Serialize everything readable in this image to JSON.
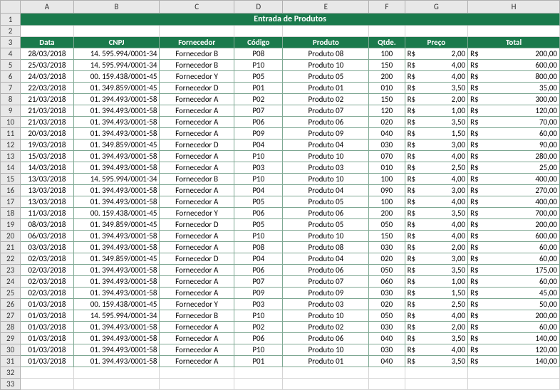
{
  "title": "Entrada de Produtos",
  "column_letters": [
    "A",
    "B",
    "C",
    "D",
    "E",
    "F",
    "G",
    "H"
  ],
  "headers": {
    "data": "Data",
    "cnpj": "CNPJ",
    "fornecedor": "Fornecedor",
    "codigo": "Código",
    "produto": "Produto",
    "qtde": "Qtde.",
    "preco": "Preço",
    "total": "Total"
  },
  "currency": "R$",
  "rows": [
    {
      "n": 4,
      "data": "28/03/2018",
      "cnpj": "14. 595.994/0001-34",
      "fornecedor": "Fornecedor B",
      "codigo": "P08",
      "produto": "Produto 08",
      "qtde": "100",
      "preco": "2,00",
      "total": "200,00"
    },
    {
      "n": 5,
      "data": "25/03/2018",
      "cnpj": "14. 595.994/0001-34",
      "fornecedor": "Fornecedor B",
      "codigo": "P10",
      "produto": "Produto 10",
      "qtde": "150",
      "preco": "4,00",
      "total": "600,00"
    },
    {
      "n": 6,
      "data": "24/03/2018",
      "cnpj": "00. 159.438/0001-45",
      "fornecedor": "Fornecedor Y",
      "codigo": "P05",
      "produto": "Produto 05",
      "qtde": "200",
      "preco": "4,00",
      "total": "800,00"
    },
    {
      "n": 7,
      "data": "22/03/2018",
      "cnpj": "01. 349.859/0001-45",
      "fornecedor": "Fornecedor D",
      "codigo": "P01",
      "produto": "Produto 01",
      "qtde": "010",
      "preco": "3,50",
      "total": "35,00"
    },
    {
      "n": 8,
      "data": "21/03/2018",
      "cnpj": "01. 394.493/0001-58",
      "fornecedor": "Fornecedor A",
      "codigo": "P02",
      "produto": "Produto 02",
      "qtde": "150",
      "preco": "2,00",
      "total": "300,00"
    },
    {
      "n": 9,
      "data": "21/03/2018",
      "cnpj": "01. 394.493/0001-58",
      "fornecedor": "Fornecedor A",
      "codigo": "P07",
      "produto": "Produto 07",
      "qtde": "120",
      "preco": "1,00",
      "total": "120,00"
    },
    {
      "n": 10,
      "data": "21/03/2018",
      "cnpj": "01. 394.493/0001-58",
      "fornecedor": "Fornecedor A",
      "codigo": "P06",
      "produto": "Produto 06",
      "qtde": "020",
      "preco": "3,50",
      "total": "70,00"
    },
    {
      "n": 11,
      "data": "20/03/2018",
      "cnpj": "01. 394.493/0001-58",
      "fornecedor": "Fornecedor A",
      "codigo": "P09",
      "produto": "Produto 09",
      "qtde": "040",
      "preco": "1,50",
      "total": "60,00"
    },
    {
      "n": 12,
      "data": "19/03/2018",
      "cnpj": "01. 349.859/0001-45",
      "fornecedor": "Fornecedor D",
      "codigo": "P04",
      "produto": "Produto 04",
      "qtde": "030",
      "preco": "3,00",
      "total": "90,00"
    },
    {
      "n": 13,
      "data": "15/03/2018",
      "cnpj": "01. 394.493/0001-58",
      "fornecedor": "Fornecedor A",
      "codigo": "P10",
      "produto": "Produto 10",
      "qtde": "070",
      "preco": "4,00",
      "total": "280,00"
    },
    {
      "n": 14,
      "data": "14/03/2018",
      "cnpj": "01. 394.493/0001-58",
      "fornecedor": "Fornecedor A",
      "codigo": "P03",
      "produto": "Produto 03",
      "qtde": "010",
      "preco": "2,50",
      "total": "25,00"
    },
    {
      "n": 15,
      "data": "13/03/2018",
      "cnpj": "14. 595.994/0001-34",
      "fornecedor": "Fornecedor B",
      "codigo": "P10",
      "produto": "Produto 10",
      "qtde": "100",
      "preco": "4,00",
      "total": "400,00"
    },
    {
      "n": 16,
      "data": "13/03/2018",
      "cnpj": "01. 394.493/0001-58",
      "fornecedor": "Fornecedor A",
      "codigo": "P04",
      "produto": "Produto 04",
      "qtde": "090",
      "preco": "3,00",
      "total": "270,00"
    },
    {
      "n": 17,
      "data": "13/03/2018",
      "cnpj": "01. 394.493/0001-58",
      "fornecedor": "Fornecedor A",
      "codigo": "P05",
      "produto": "Produto 05",
      "qtde": "100",
      "preco": "4,00",
      "total": "400,00"
    },
    {
      "n": 18,
      "data": "11/03/2018",
      "cnpj": "00. 159.438/0001-45",
      "fornecedor": "Fornecedor Y",
      "codigo": "P06",
      "produto": "Produto 06",
      "qtde": "200",
      "preco": "3,50",
      "total": "700,00"
    },
    {
      "n": 19,
      "data": "08/03/2018",
      "cnpj": "01. 349.859/0001-45",
      "fornecedor": "Fornecedor D",
      "codigo": "P05",
      "produto": "Produto 05",
      "qtde": "050",
      "preco": "4,00",
      "total": "200,00"
    },
    {
      "n": 20,
      "data": "06/03/2018",
      "cnpj": "01. 394.493/0001-58",
      "fornecedor": "Fornecedor A",
      "codigo": "P10",
      "produto": "Produto 10",
      "qtde": "150",
      "preco": "4,00",
      "total": "600,00"
    },
    {
      "n": 21,
      "data": "03/03/2018",
      "cnpj": "01. 394.493/0001-58",
      "fornecedor": "Fornecedor A",
      "codigo": "P08",
      "produto": "Produto 08",
      "qtde": "030",
      "preco": "2,00",
      "total": "60,00"
    },
    {
      "n": 22,
      "data": "02/03/2018",
      "cnpj": "01. 349.859/0001-45",
      "fornecedor": "Fornecedor D",
      "codigo": "P04",
      "produto": "Produto 04",
      "qtde": "020",
      "preco": "3,00",
      "total": "60,00"
    },
    {
      "n": 23,
      "data": "02/03/2018",
      "cnpj": "01. 394.493/0001-58",
      "fornecedor": "Fornecedor A",
      "codigo": "P06",
      "produto": "Produto 06",
      "qtde": "050",
      "preco": "3,50",
      "total": "175,00"
    },
    {
      "n": 24,
      "data": "02/03/2018",
      "cnpj": "01. 394.493/0001-58",
      "fornecedor": "Fornecedor A",
      "codigo": "P07",
      "produto": "Produto 07",
      "qtde": "060",
      "preco": "1,00",
      "total": "60,00"
    },
    {
      "n": 25,
      "data": "02/03/2018",
      "cnpj": "01. 394.493/0001-58",
      "fornecedor": "Fornecedor A",
      "codigo": "P09",
      "produto": "Produto 09",
      "qtde": "030",
      "preco": "1,50",
      "total": "45,00"
    },
    {
      "n": 26,
      "data": "01/03/2018",
      "cnpj": "00. 159.438/0001-45",
      "fornecedor": "Fornecedor Y",
      "codigo": "P03",
      "produto": "Produto 03",
      "qtde": "020",
      "preco": "2,50",
      "total": "50,00"
    },
    {
      "n": 27,
      "data": "01/03/2018",
      "cnpj": "14. 595.994/0001-34",
      "fornecedor": "Fornecedor B",
      "codigo": "P10",
      "produto": "Produto 10",
      "qtde": "050",
      "preco": "4,00",
      "total": "200,00"
    },
    {
      "n": 28,
      "data": "01/03/2018",
      "cnpj": "01. 394.493/0001-58",
      "fornecedor": "Fornecedor A",
      "codigo": "P02",
      "produto": "Produto 02",
      "qtde": "030",
      "preco": "2,00",
      "total": "60,00"
    },
    {
      "n": 29,
      "data": "01/03/2018",
      "cnpj": "01. 394.493/0001-58",
      "fornecedor": "Fornecedor A",
      "codigo": "P06",
      "produto": "Produto 06",
      "qtde": "040",
      "preco": "3,50",
      "total": "140,00"
    },
    {
      "n": 30,
      "data": "01/03/2018",
      "cnpj": "01. 394.493/0001-58",
      "fornecedor": "Fornecedor A",
      "codigo": "P10",
      "produto": "Produto 10",
      "qtde": "030",
      "preco": "4,00",
      "total": "120,00"
    },
    {
      "n": 31,
      "data": "01/03/2018",
      "cnpj": "01. 394.493/0001-58",
      "fornecedor": "Fornecedor A",
      "codigo": "P01",
      "produto": "Produto 01",
      "qtde": "040",
      "preco": "3,50",
      "total": "140,00"
    }
  ],
  "empty_rows": [
    32,
    33
  ]
}
